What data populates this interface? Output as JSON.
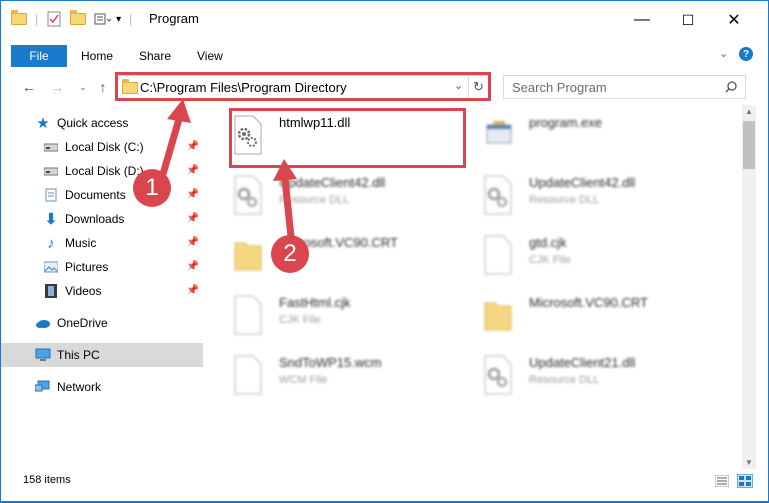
{
  "window": {
    "title": "Program",
    "minimize_glyph": "—",
    "maximize_glyph": "☐",
    "close_glyph": "✕"
  },
  "ribbon": {
    "file_label": "File",
    "tabs": [
      "Home",
      "Share",
      "View"
    ],
    "help_glyph": "?"
  },
  "address": {
    "path": "C:\\Program Files\\Program Directory",
    "search_placeholder": "Search Program"
  },
  "sidebar": {
    "items": [
      {
        "label": "Quick access",
        "icon": "star-icon",
        "pinned": false
      },
      {
        "label": "Local Disk (C:)",
        "icon": "drive-icon",
        "pinned": true
      },
      {
        "label": "Local Disk (D:)",
        "icon": "drive-icon",
        "pinned": true
      },
      {
        "label": "Documents",
        "icon": "documents-icon",
        "pinned": true
      },
      {
        "label": "Downloads",
        "icon": "download-icon",
        "pinned": true
      },
      {
        "label": "Music",
        "icon": "music-icon",
        "pinned": true
      },
      {
        "label": "Pictures",
        "icon": "pictures-icon",
        "pinned": true
      },
      {
        "label": "Videos",
        "icon": "videos-icon",
        "pinned": true
      },
      {
        "label": "OneDrive",
        "icon": "cloud-icon",
        "pinned": false
      },
      {
        "label": "This PC",
        "icon": "computer-icon",
        "pinned": false,
        "selected": true
      },
      {
        "label": "Network",
        "icon": "network-icon",
        "pinned": false
      }
    ]
  },
  "files": [
    {
      "name": "htmlwp11.dll",
      "type": "",
      "icon": "dll-gear-icon"
    },
    {
      "name": "program.exe",
      "type": "",
      "icon": "exe-icon"
    },
    {
      "name": "UpdateClient42.dll",
      "type": "Resource DLL",
      "icon": "dll-gear-icon"
    },
    {
      "name": "UpdateClient42.dll",
      "type": "Resource DLL",
      "icon": "dll-gear-icon"
    },
    {
      "name": "Microsoft.VC90.CRT",
      "type": "",
      "icon": "folder-icon"
    },
    {
      "name": "gtd.cjk",
      "type": "CJK File",
      "icon": "file-icon"
    },
    {
      "name": "FastHtml.cjk",
      "type": "CJK File",
      "icon": "file-icon"
    },
    {
      "name": "Microsoft.VC90.CRT",
      "type": "",
      "icon": "folder-icon"
    },
    {
      "name": "SndToWP15.wcm",
      "type": "WCM File",
      "icon": "file-icon"
    },
    {
      "name": "UpdateClient21.dll",
      "type": "Resource DLL",
      "icon": "dll-gear-icon"
    }
  ],
  "status": {
    "count": "158 items"
  },
  "callouts": [
    "1",
    "2"
  ],
  "colors": {
    "accent": "#1979ca",
    "highlight": "#d9464e"
  }
}
